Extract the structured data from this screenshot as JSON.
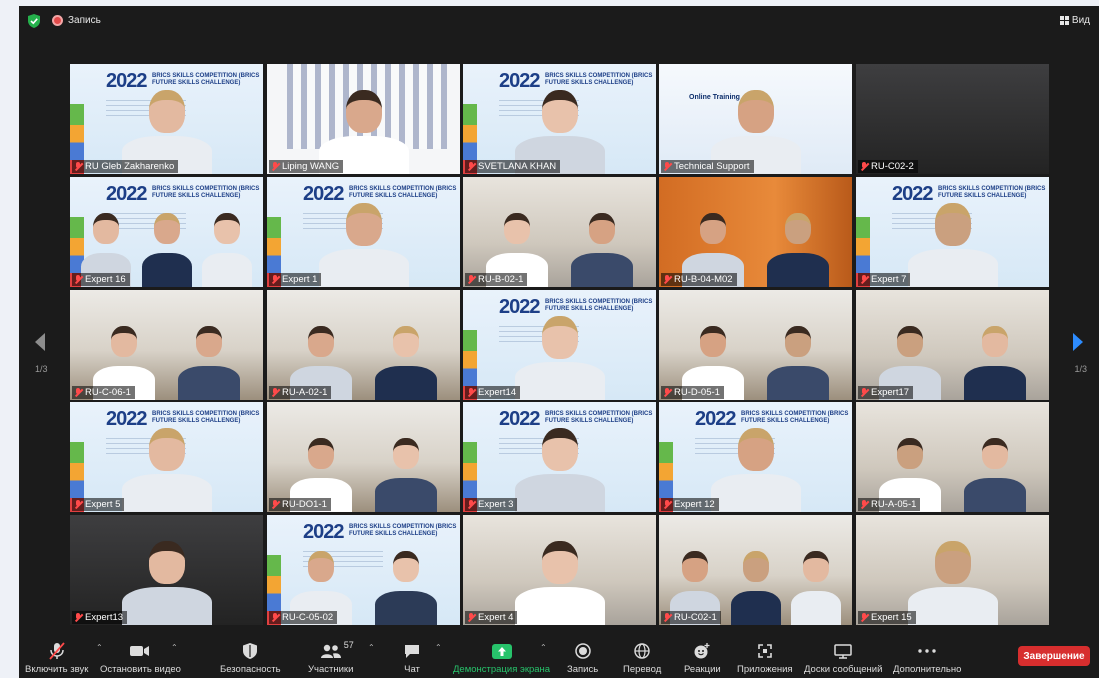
{
  "topbar": {
    "recording_label": "Запись",
    "view_label": "Вид"
  },
  "pagination": {
    "left": "1/3",
    "right": "1/3"
  },
  "participants": [
    "RU Gleb Zakharenko",
    "Liping WANG",
    "SVETLANA KHAN",
    "Technical Support",
    "RU-C02-2",
    "Expert 16",
    "Expert 1",
    "RU-B-02-1",
    "RU-B-04-M02",
    "Expert 7",
    "RU-C-06-1",
    "RU-A-02-1",
    "Expert14",
    "RU-D-05-1",
    "Expert17",
    "Expert 5",
    "RU-DO1-1",
    "Expert 3",
    "Expert 12",
    "RU-A-05-1",
    "Expert13",
    "RU-C-05-02",
    "Expert 4",
    "RU-C02-1",
    "Expert 15"
  ],
  "slide_text": {
    "year": "2022",
    "title": "BRICS SKILLS COMPETITION (BRICS FUTURE SKILLS CHALLENGE)",
    "support_title": "Online Training"
  },
  "toolbar": {
    "mute": "Включить звук",
    "video": "Остановить видео",
    "security": "Безопасность",
    "participants": "Участники",
    "participants_count": "57",
    "chat": "Чат",
    "share": "Демонстрация экрана",
    "record": "Запись",
    "translate": "Перевод",
    "reactions": "Реакции",
    "apps": "Приложения",
    "whiteboards": "Доски сообщений",
    "more": "Дополнительно",
    "end": "Завершение"
  },
  "colors": {
    "active_speaker": "#b9e04e",
    "share_green": "#27c36b",
    "end_red": "#d72e2e",
    "muted_red": "#ff4a4a"
  }
}
